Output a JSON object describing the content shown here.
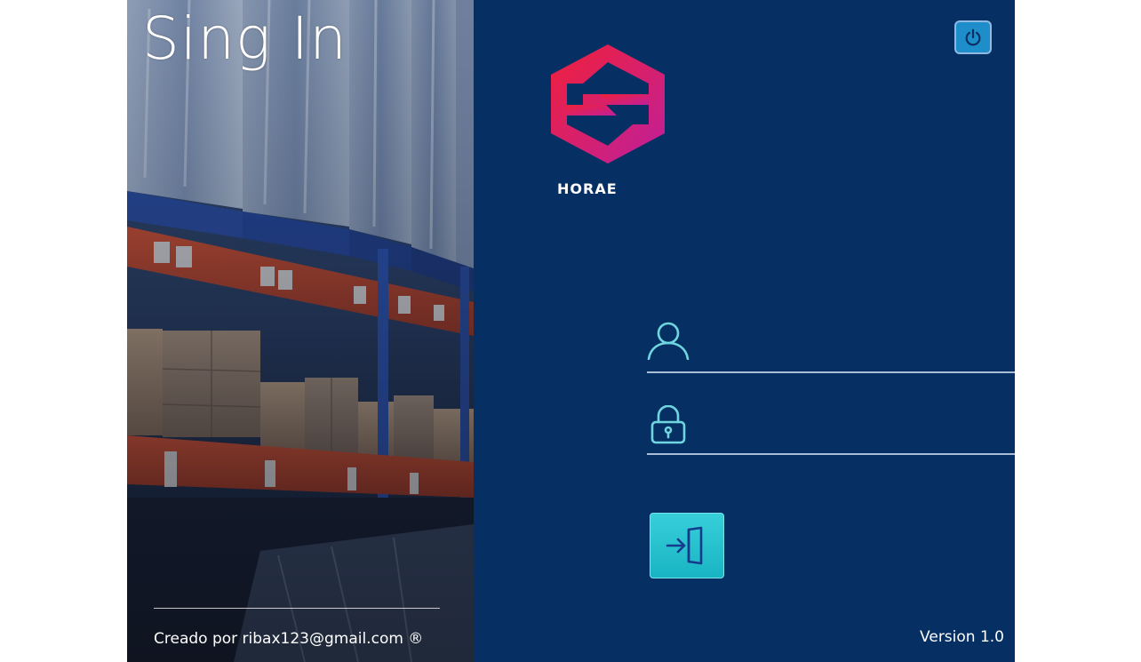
{
  "title": "Sing In",
  "credit": "Creado por ribax123@gmail.com ®",
  "brand": {
    "name": "HORAE",
    "colors": [
      "#ef1f35",
      "#c41f8f"
    ]
  },
  "fields": {
    "username": {
      "value": "",
      "icon": "user-icon"
    },
    "password": {
      "value": "",
      "icon": "lock-icon"
    }
  },
  "buttons": {
    "power": {
      "icon": "power-icon"
    },
    "login": {
      "icon": "sign-in-icon"
    }
  },
  "version": "Version 1.0",
  "colors": {
    "panel": "#063064",
    "login_button": "#22bfcd",
    "power_button": "#1d8ec9"
  }
}
